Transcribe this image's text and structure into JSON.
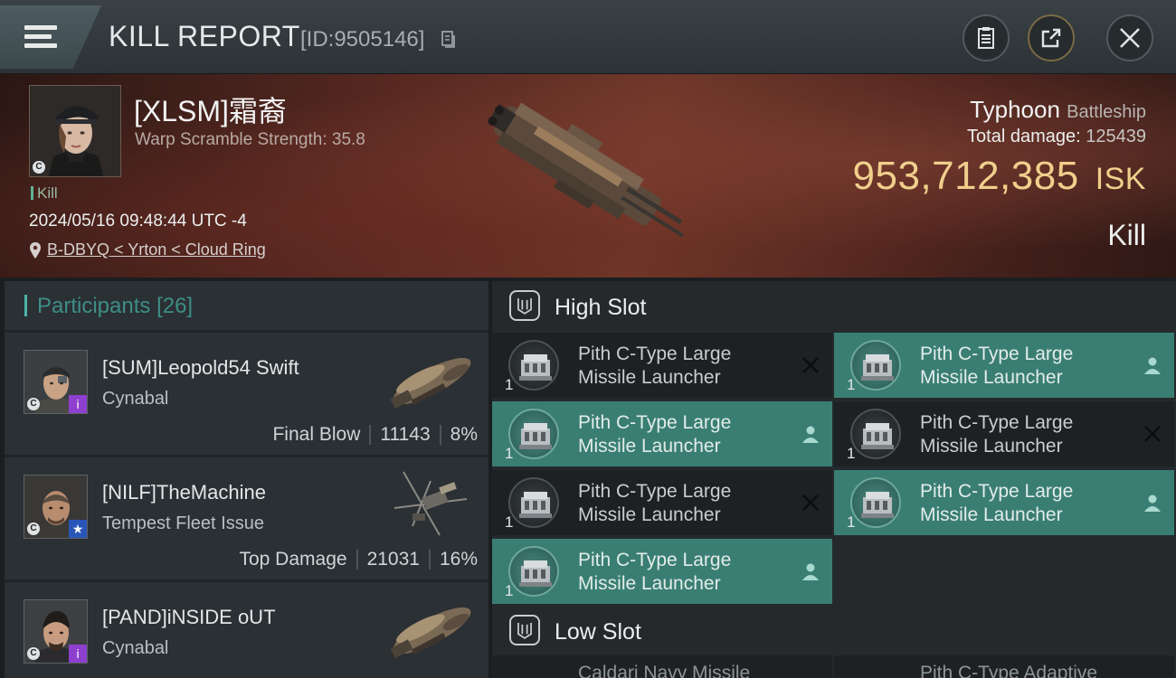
{
  "header": {
    "title": "KILL REPORT",
    "id_label": "[ID:9505146]"
  },
  "victim": {
    "name": "[XLSM]霜裔",
    "scramble": "Warp Scramble Strength: 35.8",
    "tag": "Kill",
    "datetime": "2024/05/16 09:48:44 UTC -4",
    "location": "B-DBYQ < Yrton < Cloud Ring",
    "ship_name": "Typhoon",
    "ship_class": "Battleship",
    "total_damage_label": "Total damage:",
    "total_damage": "125439",
    "isk_value": "953,712,385",
    "isk_unit": "ISK",
    "result": "Kill",
    "corp_badge": "C"
  },
  "participants": {
    "title": "Participants",
    "count": "[26]",
    "items": [
      {
        "name": "[SUM]Leopold54 Swift",
        "ship": "Cynabal",
        "role": "Final Blow",
        "damage": "11143",
        "percent": "8%",
        "badge": "purple",
        "corp": "C",
        "badge_glyph": "i"
      },
      {
        "name": "[NILF]TheMachine",
        "ship": "Tempest Fleet Issue",
        "role": "Top Damage",
        "damage": "21031",
        "percent": "16%",
        "badge": "blue",
        "corp": "C",
        "badge_glyph": "★"
      },
      {
        "name": "[PAND]iNSIDE oUT",
        "ship": "Cynabal",
        "role": "",
        "damage": "",
        "percent": "",
        "badge": "purple",
        "corp": "C",
        "badge_glyph": "i"
      }
    ]
  },
  "fitting": {
    "high_slot_title": "High Slot",
    "low_slot_title": "Low Slot",
    "high_modules": [
      {
        "line1": "Pith C-Type Large",
        "line2": "Missile Launcher",
        "qty": "1",
        "status": "destroyed"
      },
      {
        "line1": "Pith C-Type Large",
        "line2": "Missile Launcher",
        "qty": "1",
        "status": "dropped"
      },
      {
        "line1": "Pith C-Type Large",
        "line2": "Missile Launcher",
        "qty": "1",
        "status": "dropped"
      },
      {
        "line1": "Pith C-Type Large",
        "line2": "Missile Launcher",
        "qty": "1",
        "status": "destroyed"
      },
      {
        "line1": "Pith C-Type Large",
        "line2": "Missile Launcher",
        "qty": "1",
        "status": "destroyed"
      },
      {
        "line1": "Pith C-Type Large",
        "line2": "Missile Launcher",
        "qty": "1",
        "status": "dropped"
      },
      {
        "line1": "Pith C-Type Large",
        "line2": "Missile Launcher",
        "qty": "1",
        "status": "dropped"
      }
    ],
    "low_partial": [
      "Caldari Navy Missile",
      "Pith C-Type Adaptive"
    ]
  },
  "colors": {
    "accent_teal": "#3a7e73",
    "isk_gold": "#f0cf8c",
    "participants_title": "#3e8e86"
  },
  "icons": {
    "menu": "hamburger-icon",
    "copy": "copy-icon",
    "clipboard": "clipboard-icon",
    "share": "share-icon",
    "close": "close-icon",
    "location": "location-pin-icon",
    "slot": "high-slot-icon"
  }
}
